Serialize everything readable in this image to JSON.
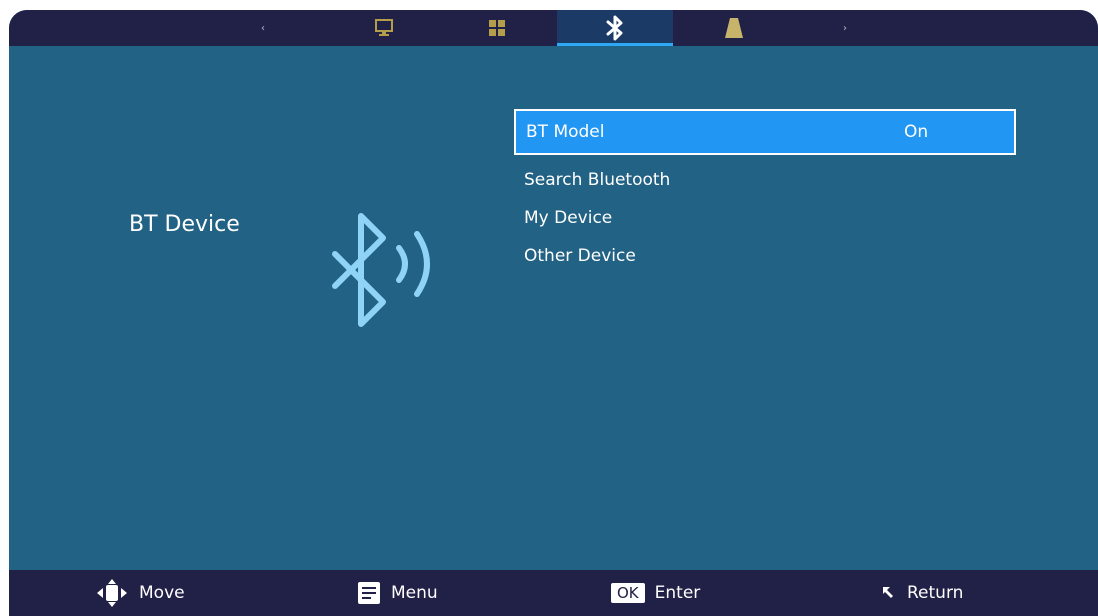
{
  "topbar": {
    "tabs": [
      {
        "icon": "monitor-icon",
        "active": false
      },
      {
        "icon": "grid-apps-icon",
        "active": false
      },
      {
        "icon": "bluetooth-icon",
        "active": true
      },
      {
        "icon": "bell-icon",
        "active": false
      }
    ],
    "left_arrow": "‹",
    "right_arrow": "›"
  },
  "main": {
    "section_label": "BT Device",
    "menu": [
      {
        "label": "BT Model",
        "value": "On"
      },
      {
        "label": "Search Bluetooth"
      },
      {
        "label": "My Device"
      },
      {
        "label": "Other Device"
      }
    ]
  },
  "bottombar": {
    "move_label": "Move",
    "menu_label": "Menu",
    "ok_key": "OK",
    "enter_label": "Enter",
    "return_label": "Return"
  },
  "colors": {
    "bar": "#212046",
    "panel": "#226284",
    "selected": "#2196f3",
    "accent": "#2ea7f5",
    "icon_light": "#8fd3f6",
    "icon_muted": "#c7b46a"
  }
}
